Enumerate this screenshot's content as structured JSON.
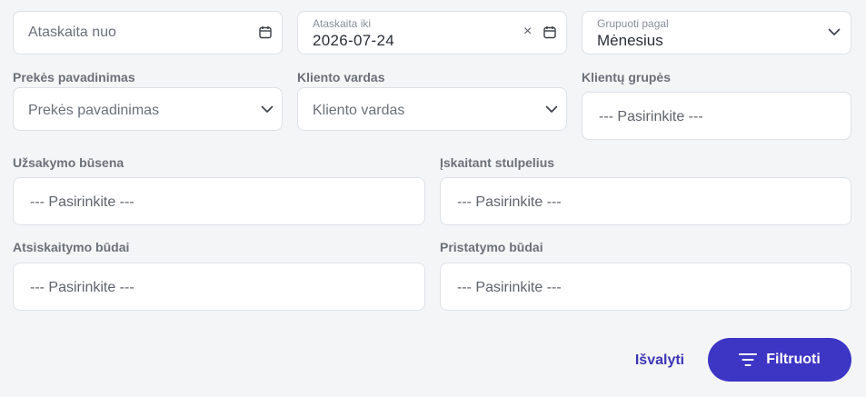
{
  "filters": {
    "date_from": {
      "placeholder": "Ataskaita nuo"
    },
    "date_to": {
      "label": "Ataskaita iki",
      "value": "2026-07-24",
      "clear_glyph": "×"
    },
    "group_by": {
      "label": "Grupuoti pagal",
      "value": "Mėnesius"
    },
    "product_name": {
      "label": "Prekės pavadinimas",
      "placeholder": "Prekės pavadinimas"
    },
    "client_name": {
      "label": "Kliento vardas",
      "placeholder": "Kliento vardas"
    },
    "client_groups": {
      "label": "Klientų grupės",
      "placeholder": "--- Pasirinkite ---"
    },
    "order_status": {
      "label": "Užsakymo būsena",
      "placeholder": "--- Pasirinkite ---"
    },
    "columns": {
      "label": "Įskaitant stulpelius",
      "placeholder": "--- Pasirinkite ---"
    },
    "payment_methods": {
      "label": "Atsiskaitymo būdai",
      "placeholder": "--- Pasirinkite ---"
    },
    "delivery_methods": {
      "label": "Pristatymo būdai",
      "placeholder": "--- Pasirinkite ---"
    }
  },
  "actions": {
    "clear_label": "Išvalyti",
    "filter_label": "Filtruoti"
  },
  "icons": {
    "calendar": "calendar-icon",
    "chevron": "chevron-down-icon",
    "clear": "close-icon",
    "filter": "filter-icon"
  },
  "colors": {
    "background": "#f4f5f7",
    "border": "#dde1e6",
    "accent": "#3d35c4",
    "link": "#3d35b5",
    "label": "#6c7078"
  }
}
